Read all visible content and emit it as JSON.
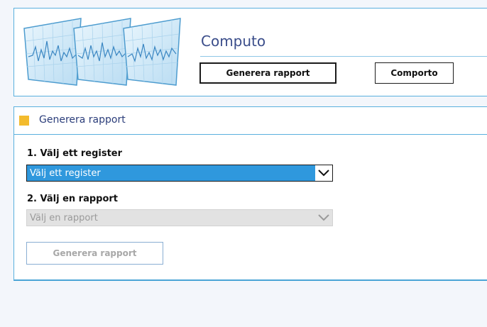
{
  "app": {
    "title": "Computo"
  },
  "nav": {
    "generate_label": "Generera rapport",
    "comporto_label": "Comporto"
  },
  "panel": {
    "title": "Generera rapport",
    "accent_color": "#f3bb2d",
    "border_color": "#5ab0de"
  },
  "form": {
    "register": {
      "label": "1. Välj ett register",
      "value": "Välj ett register",
      "state": "focused"
    },
    "report": {
      "label": "2. Välj en rapport",
      "value": "Välj en rapport",
      "state": "disabled"
    },
    "submit_label": "Generera rapport",
    "submit_state": "disabled"
  },
  "icons": {
    "logo": "waveform-monitors-logo",
    "select_arrow": "chevron-down-icon"
  }
}
